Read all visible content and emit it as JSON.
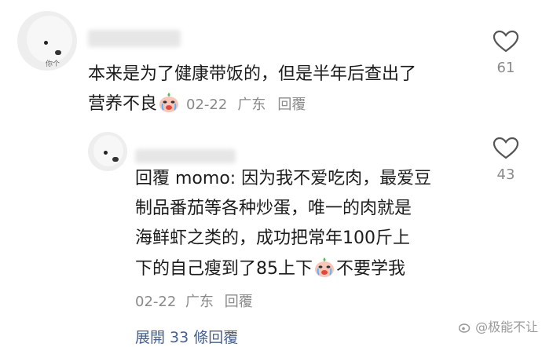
{
  "comment": {
    "text_line1": "本来是为了健康带饭的，但是半年后查出了",
    "text_line2": "营养不良",
    "date": "02-22",
    "location": "广东",
    "reply_label": "回覆",
    "like_count": "61",
    "avatar_text": "你个"
  },
  "reply": {
    "line1": "回覆 momo: 因为我不爱吃肉，最爱豆",
    "line2": "制品番茄等各种炒蛋，唯一的肉就是",
    "line3": "海鲜虾之类的，成功把常年100斤上",
    "line4_a": "下的自己瘦到了85上下",
    "line4_b": "不要学我",
    "date": "02-22",
    "location": "广东",
    "reply_label": "回覆",
    "like_count": "43"
  },
  "expand_label": "展開 33 條回覆",
  "watermark": "@极能不让",
  "colors": {
    "text": "#1c1c1c",
    "meta": "#8a8a8a",
    "link": "#46618f"
  },
  "icons": [
    "heart-outline-icon",
    "crying-emoji-icon",
    "weibo-logo-icon"
  ]
}
